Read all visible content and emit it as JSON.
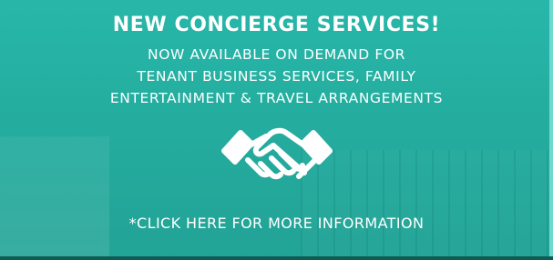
{
  "banner": {
    "headline": "NEW CONCIERGE SERVICES!",
    "lines": [
      "NOW AVAILABLE ON DEMAND FOR",
      "TENANT BUSINESS SERVICES, FAMILY",
      "ENTERTAINMENT & TRAVEL ARRANGEMENTS"
    ],
    "icon": "handshake-icon",
    "cta": "*CLICK HERE FOR MORE INFORMATION",
    "colors": {
      "background": "#24ad9f",
      "text": "#ffffff"
    }
  }
}
